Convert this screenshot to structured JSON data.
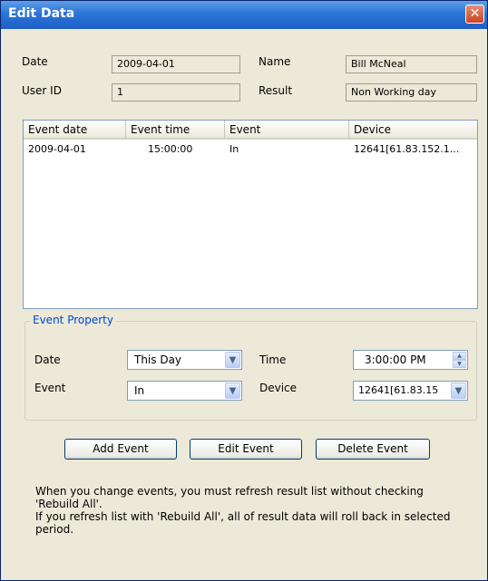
{
  "window": {
    "title": "Edit Data",
    "close_icon": "✕"
  },
  "summary": {
    "date_label": "Date",
    "date_value": "2009-04-01",
    "name_label": "Name",
    "name_value": "Bill McNeal",
    "userid_label": "User ID",
    "userid_value": "1",
    "result_label": "Result",
    "result_value": "Non Working day"
  },
  "events_table": {
    "columns": [
      "Event date",
      "Event time",
      "Event",
      "Device"
    ],
    "rows": [
      {
        "date": "2009-04-01",
        "time": "15:00:00",
        "event": "In",
        "device": "12641[61.83.152.1..."
      }
    ]
  },
  "event_property": {
    "legend": "Event Property",
    "date_label": "Date",
    "date_value": "This Day",
    "time_label": "Time",
    "time_value": "3:00:00 PM",
    "event_label": "Event",
    "event_value": "In",
    "device_label": "Device",
    "device_value": "12641[61.83.15"
  },
  "buttons": {
    "add": "Add Event",
    "edit": "Edit Event",
    "delete": "Delete Event"
  },
  "note": {
    "line1": "When you change events, you must refresh result list without checking",
    "line2": "'Rebuild All'.",
    "line3": "If you refresh list with 'Rebuild All', all of result data will roll back in selected",
    "line4": "period."
  },
  "icons": {
    "dropdown": "chevron-down-icon",
    "spin_up": "chevron-up-icon",
    "spin_down": "chevron-down-icon"
  }
}
